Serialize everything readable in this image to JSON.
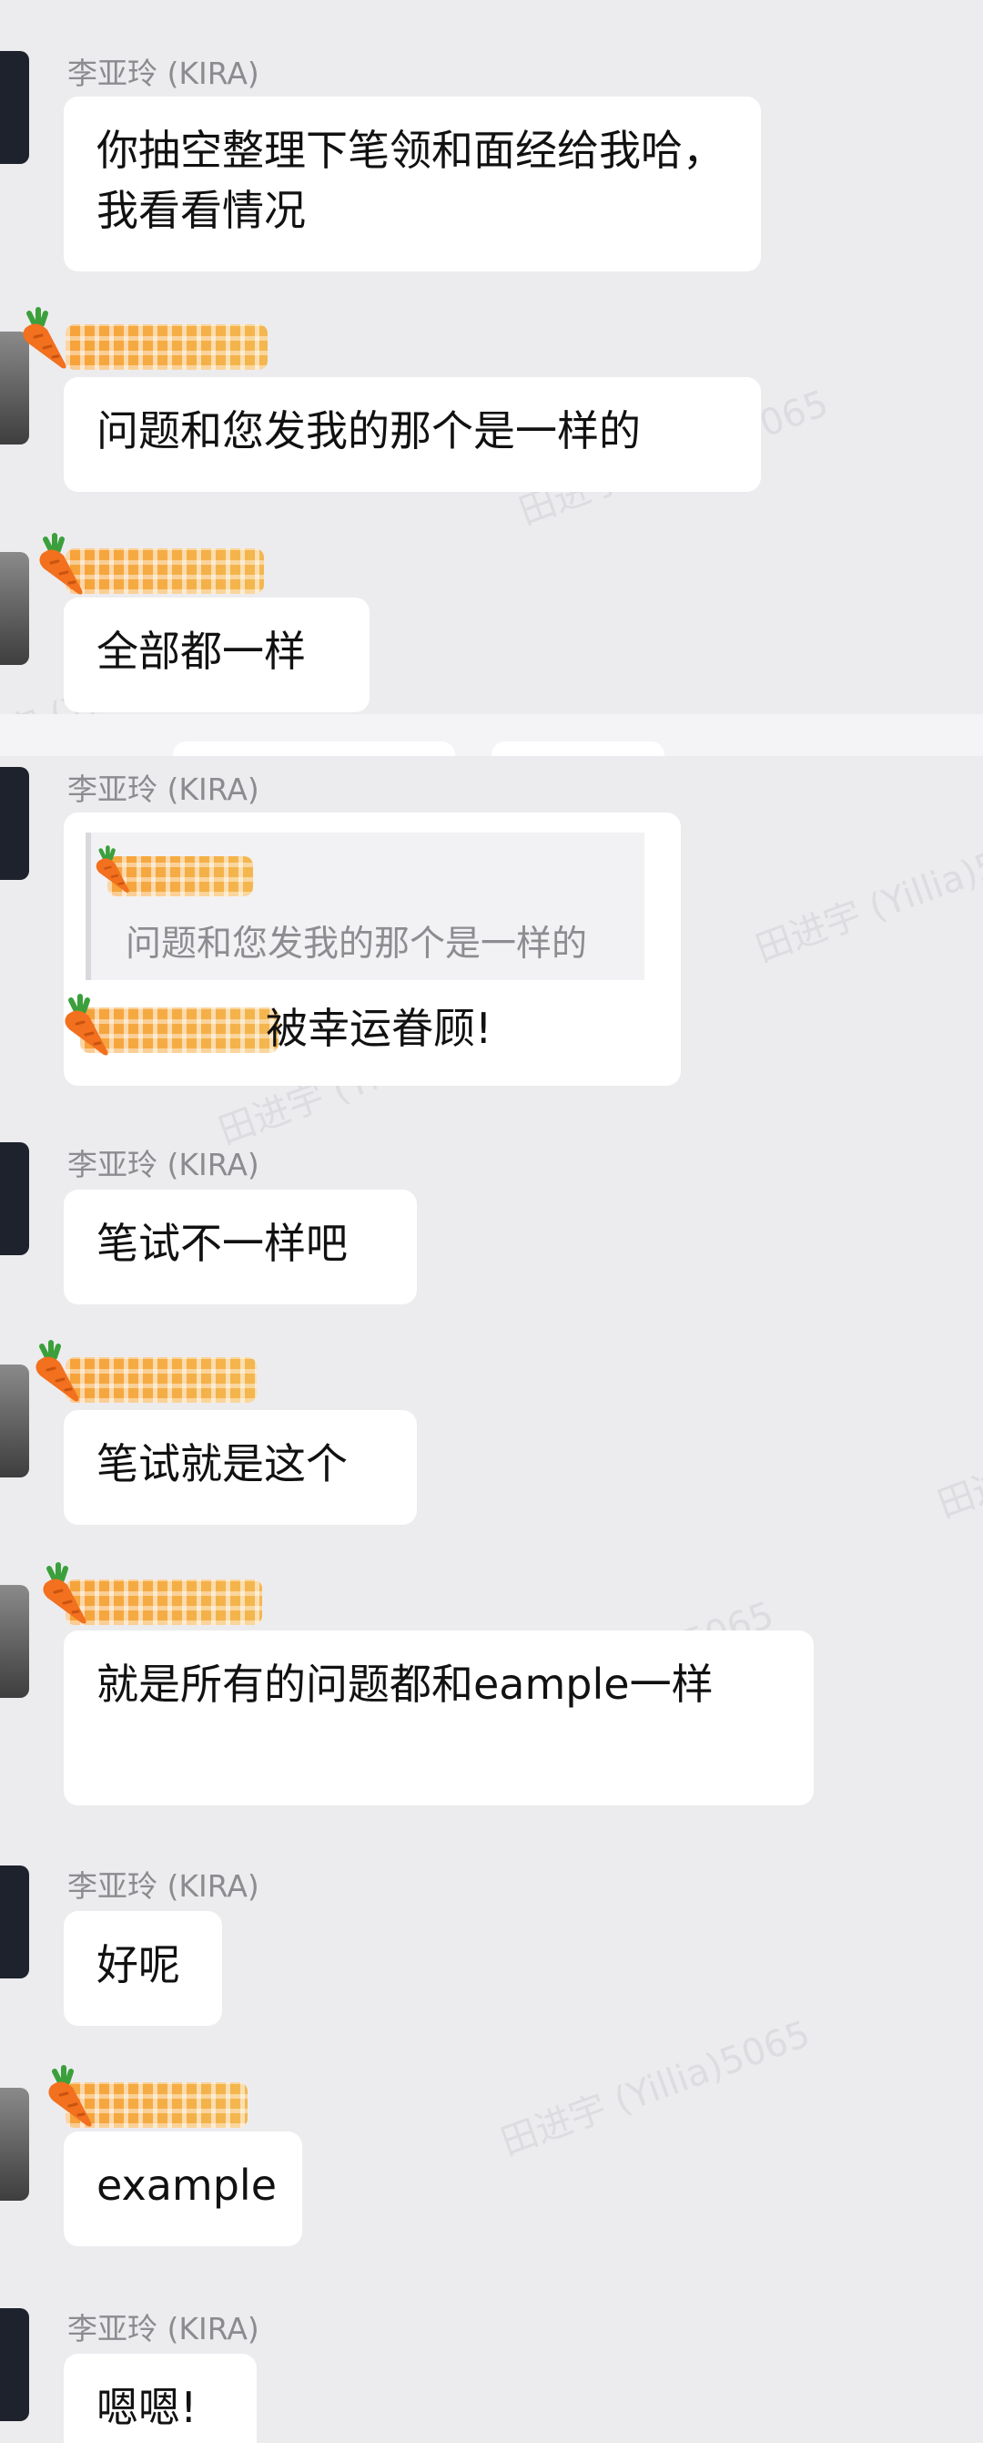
{
  "sender_name": "李亚玲 (KIRA)",
  "watermark": "田进宇 (Yillia)5065",
  "messages": [
    {
      "text": "你抽空整理下笔领和面经给我哈，我看看情况"
    },
    {
      "text": "问题和您发我的那个是一样的"
    },
    {
      "text": "全部都一样"
    },
    {
      "quote": "问题和您发我的那个是一样的",
      "text": "被幸运眷顾!"
    },
    {
      "text": "笔试不一样吧"
    },
    {
      "text": "笔试就是这个"
    },
    {
      "text": "就是所有的问题都和eample一样"
    },
    {
      "text": "好呢"
    },
    {
      "text": "example"
    },
    {
      "text": "嗯嗯!"
    }
  ],
  "icons": {
    "carrot": "carrot-icon"
  },
  "colors": {
    "background": "#ECECEF",
    "bubble": "#FFFFFF",
    "name_highlight": "#F6A23A"
  }
}
